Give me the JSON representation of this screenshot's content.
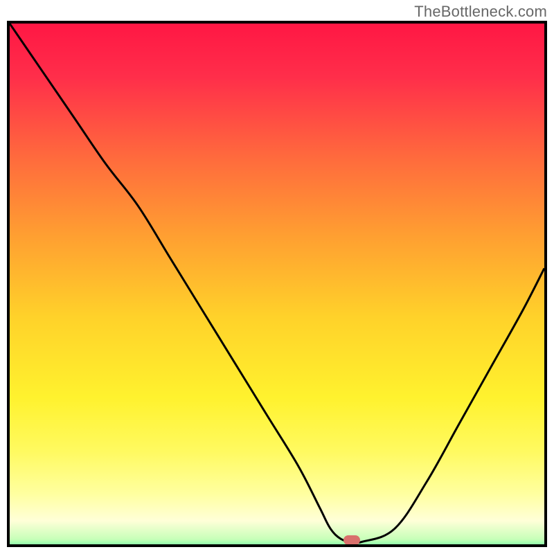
{
  "watermark": "TheBottleneck.com",
  "colors": {
    "frame": "#000000",
    "curve": "#000000",
    "marker_fill": "#d9706c",
    "gradient_stops": [
      {
        "offset": 0.0,
        "color": "#ff1744"
      },
      {
        "offset": 0.1,
        "color": "#ff2e4a"
      },
      {
        "offset": 0.25,
        "color": "#ff6a3d"
      },
      {
        "offset": 0.4,
        "color": "#ffa031"
      },
      {
        "offset": 0.55,
        "color": "#ffd22a"
      },
      {
        "offset": 0.7,
        "color": "#fff22e"
      },
      {
        "offset": 0.8,
        "color": "#fffa60"
      },
      {
        "offset": 0.88,
        "color": "#ffffa0"
      },
      {
        "offset": 0.93,
        "color": "#ffffd8"
      },
      {
        "offset": 0.965,
        "color": "#c6ffb8"
      },
      {
        "offset": 0.985,
        "color": "#56ff9c"
      },
      {
        "offset": 1.0,
        "color": "#1de993"
      }
    ]
  },
  "chart_data": {
    "type": "line",
    "title": "",
    "xlabel": "",
    "ylabel": "",
    "xlim": [
      0,
      100
    ],
    "ylim": [
      0,
      100
    ],
    "grid": false,
    "legend": false,
    "series": [
      {
        "name": "bottleneck-curve",
        "x": [
          0,
          6,
          12,
          18,
          24,
          30,
          36,
          42,
          48,
          54,
          58,
          60,
          62,
          64,
          66,
          72,
          78,
          84,
          90,
          96,
          100
        ],
        "y": [
          100,
          91,
          82,
          73,
          65,
          55,
          45,
          35,
          25,
          15,
          7,
          3,
          1,
          0.5,
          0.5,
          3,
          12,
          23,
          34,
          45,
          53
        ]
      }
    ],
    "annotations": [
      {
        "name": "sweet-spot-marker",
        "shape": "pill",
        "x": 64,
        "y": 0.8,
        "color": "#d9706c"
      }
    ]
  }
}
